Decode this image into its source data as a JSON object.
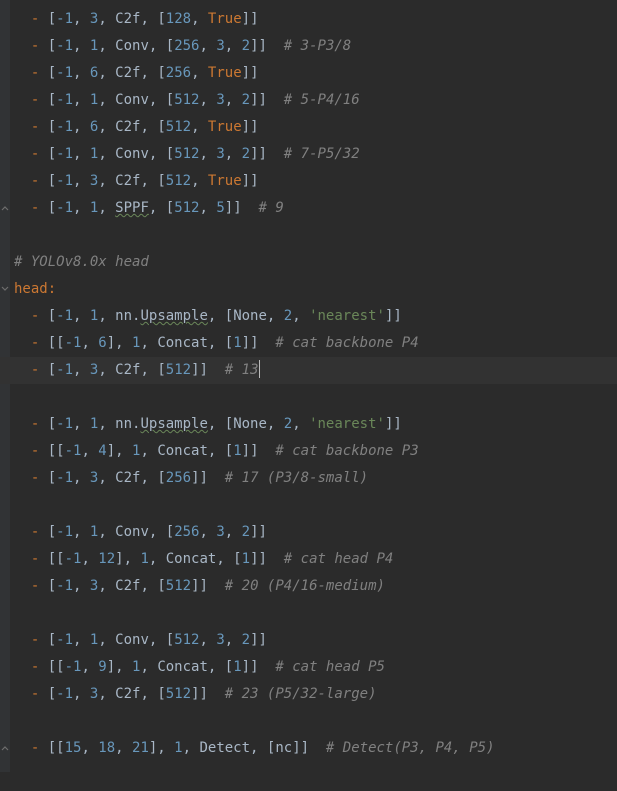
{
  "lines": [
    {
      "indent": "  ",
      "dash": "- ",
      "segs": [
        {
          "t": "bracket",
          "v": "["
        },
        {
          "t": "num",
          "v": "-1"
        },
        {
          "t": "bracket",
          "v": ", "
        },
        {
          "t": "num",
          "v": "3"
        },
        {
          "t": "bracket",
          "v": ", "
        },
        {
          "t": "ident",
          "v": "C2f"
        },
        {
          "t": "bracket",
          "v": ", ["
        },
        {
          "t": "num",
          "v": "128"
        },
        {
          "t": "bracket",
          "v": ", "
        },
        {
          "t": "bool",
          "v": "True"
        },
        {
          "t": "bracket",
          "v": "]]"
        }
      ]
    },
    {
      "indent": "  ",
      "dash": "- ",
      "segs": [
        {
          "t": "bracket",
          "v": "["
        },
        {
          "t": "num",
          "v": "-1"
        },
        {
          "t": "bracket",
          "v": ", "
        },
        {
          "t": "num",
          "v": "1"
        },
        {
          "t": "bracket",
          "v": ", "
        },
        {
          "t": "ident",
          "v": "Conv"
        },
        {
          "t": "bracket",
          "v": ", ["
        },
        {
          "t": "num",
          "v": "256"
        },
        {
          "t": "bracket",
          "v": ", "
        },
        {
          "t": "num",
          "v": "3"
        },
        {
          "t": "bracket",
          "v": ", "
        },
        {
          "t": "num",
          "v": "2"
        },
        {
          "t": "bracket",
          "v": "]]  "
        },
        {
          "t": "comment",
          "v": "# 3-P3/8"
        }
      ]
    },
    {
      "indent": "  ",
      "dash": "- ",
      "segs": [
        {
          "t": "bracket",
          "v": "["
        },
        {
          "t": "num",
          "v": "-1"
        },
        {
          "t": "bracket",
          "v": ", "
        },
        {
          "t": "num",
          "v": "6"
        },
        {
          "t": "bracket",
          "v": ", "
        },
        {
          "t": "ident",
          "v": "C2f"
        },
        {
          "t": "bracket",
          "v": ", ["
        },
        {
          "t": "num",
          "v": "256"
        },
        {
          "t": "bracket",
          "v": ", "
        },
        {
          "t": "bool",
          "v": "True"
        },
        {
          "t": "bracket",
          "v": "]]"
        }
      ]
    },
    {
      "indent": "  ",
      "dash": "- ",
      "segs": [
        {
          "t": "bracket",
          "v": "["
        },
        {
          "t": "num",
          "v": "-1"
        },
        {
          "t": "bracket",
          "v": ", "
        },
        {
          "t": "num",
          "v": "1"
        },
        {
          "t": "bracket",
          "v": ", "
        },
        {
          "t": "ident",
          "v": "Conv"
        },
        {
          "t": "bracket",
          "v": ", ["
        },
        {
          "t": "num",
          "v": "512"
        },
        {
          "t": "bracket",
          "v": ", "
        },
        {
          "t": "num",
          "v": "3"
        },
        {
          "t": "bracket",
          "v": ", "
        },
        {
          "t": "num",
          "v": "2"
        },
        {
          "t": "bracket",
          "v": "]]  "
        },
        {
          "t": "comment",
          "v": "# 5-P4/16"
        }
      ]
    },
    {
      "indent": "  ",
      "dash": "- ",
      "segs": [
        {
          "t": "bracket",
          "v": "["
        },
        {
          "t": "num",
          "v": "-1"
        },
        {
          "t": "bracket",
          "v": ", "
        },
        {
          "t": "num",
          "v": "6"
        },
        {
          "t": "bracket",
          "v": ", "
        },
        {
          "t": "ident",
          "v": "C2f"
        },
        {
          "t": "bracket",
          "v": ", ["
        },
        {
          "t": "num",
          "v": "512"
        },
        {
          "t": "bracket",
          "v": ", "
        },
        {
          "t": "bool",
          "v": "True"
        },
        {
          "t": "bracket",
          "v": "]]"
        }
      ]
    },
    {
      "indent": "  ",
      "dash": "- ",
      "segs": [
        {
          "t": "bracket",
          "v": "["
        },
        {
          "t": "num",
          "v": "-1"
        },
        {
          "t": "bracket",
          "v": ", "
        },
        {
          "t": "num",
          "v": "1"
        },
        {
          "t": "bracket",
          "v": ", "
        },
        {
          "t": "ident",
          "v": "Conv"
        },
        {
          "t": "bracket",
          "v": ", ["
        },
        {
          "t": "num",
          "v": "512"
        },
        {
          "t": "bracket",
          "v": ", "
        },
        {
          "t": "num",
          "v": "3"
        },
        {
          "t": "bracket",
          "v": ", "
        },
        {
          "t": "num",
          "v": "2"
        },
        {
          "t": "bracket",
          "v": "]]  "
        },
        {
          "t": "comment",
          "v": "# 7-P5/32"
        }
      ]
    },
    {
      "indent": "  ",
      "dash": "- ",
      "segs": [
        {
          "t": "bracket",
          "v": "["
        },
        {
          "t": "num",
          "v": "-1"
        },
        {
          "t": "bracket",
          "v": ", "
        },
        {
          "t": "num",
          "v": "3"
        },
        {
          "t": "bracket",
          "v": ", "
        },
        {
          "t": "ident",
          "v": "C2f"
        },
        {
          "t": "bracket",
          "v": ", ["
        },
        {
          "t": "num",
          "v": "512"
        },
        {
          "t": "bracket",
          "v": ", "
        },
        {
          "t": "bool",
          "v": "True"
        },
        {
          "t": "bracket",
          "v": "]]"
        }
      ]
    },
    {
      "indent": "  ",
      "dash": "- ",
      "fold": "up",
      "segs": [
        {
          "t": "bracket",
          "v": "["
        },
        {
          "t": "num",
          "v": "-1"
        },
        {
          "t": "bracket",
          "v": ", "
        },
        {
          "t": "num",
          "v": "1"
        },
        {
          "t": "bracket",
          "v": ", "
        },
        {
          "t": "typo",
          "v": "SPPF"
        },
        {
          "t": "bracket",
          "v": ", ["
        },
        {
          "t": "num",
          "v": "512"
        },
        {
          "t": "bracket",
          "v": ", "
        },
        {
          "t": "num",
          "v": "5"
        },
        {
          "t": "bracket",
          "v": "]]  "
        },
        {
          "t": "comment",
          "v": "# 9"
        }
      ]
    },
    {
      "blank": true
    },
    {
      "indent": "",
      "segs": [
        {
          "t": "comment",
          "v": "# YOLOv8.0x head"
        }
      ]
    },
    {
      "indent": "",
      "fold": "down",
      "segs": [
        {
          "t": "key",
          "v": "head"
        },
        {
          "t": "colon",
          "v": ":"
        }
      ]
    },
    {
      "indent": "  ",
      "dash": "- ",
      "segs": [
        {
          "t": "bracket",
          "v": "["
        },
        {
          "t": "num",
          "v": "-1"
        },
        {
          "t": "bracket",
          "v": ", "
        },
        {
          "t": "num",
          "v": "1"
        },
        {
          "t": "bracket",
          "v": ", "
        },
        {
          "t": "ident",
          "v": "nn."
        },
        {
          "t": "typo",
          "v": "Upsample"
        },
        {
          "t": "bracket",
          "v": ", ["
        },
        {
          "t": "ident",
          "v": "None"
        },
        {
          "t": "bracket",
          "v": ", "
        },
        {
          "t": "num",
          "v": "2"
        },
        {
          "t": "bracket",
          "v": ", "
        },
        {
          "t": "str",
          "v": "'nearest'"
        },
        {
          "t": "bracket",
          "v": "]]"
        }
      ]
    },
    {
      "indent": "  ",
      "dash": "- ",
      "segs": [
        {
          "t": "bracket",
          "v": "[["
        },
        {
          "t": "num",
          "v": "-1"
        },
        {
          "t": "bracket",
          "v": ", "
        },
        {
          "t": "num",
          "v": "6"
        },
        {
          "t": "bracket",
          "v": "], "
        },
        {
          "t": "num",
          "v": "1"
        },
        {
          "t": "bracket",
          "v": ", "
        },
        {
          "t": "ident",
          "v": "Concat"
        },
        {
          "t": "bracket",
          "v": ", ["
        },
        {
          "t": "num",
          "v": "1"
        },
        {
          "t": "bracket",
          "v": "]]  "
        },
        {
          "t": "comment",
          "v": "# cat backbone P4"
        }
      ]
    },
    {
      "indent": "  ",
      "dash": "- ",
      "highlight": true,
      "cursor": true,
      "segs": [
        {
          "t": "bracket",
          "v": "["
        },
        {
          "t": "num",
          "v": "-1"
        },
        {
          "t": "bracket",
          "v": ", "
        },
        {
          "t": "num",
          "v": "3"
        },
        {
          "t": "bracket",
          "v": ", "
        },
        {
          "t": "ident",
          "v": "C2f"
        },
        {
          "t": "bracket",
          "v": ", ["
        },
        {
          "t": "num",
          "v": "512"
        },
        {
          "t": "bracket",
          "v": "]]  "
        },
        {
          "t": "comment",
          "v": "# 13"
        }
      ]
    },
    {
      "blank": true
    },
    {
      "indent": "  ",
      "dash": "- ",
      "segs": [
        {
          "t": "bracket",
          "v": "["
        },
        {
          "t": "num",
          "v": "-1"
        },
        {
          "t": "bracket",
          "v": ", "
        },
        {
          "t": "num",
          "v": "1"
        },
        {
          "t": "bracket",
          "v": ", "
        },
        {
          "t": "ident",
          "v": "nn."
        },
        {
          "t": "typo",
          "v": "Upsample"
        },
        {
          "t": "bracket",
          "v": ", ["
        },
        {
          "t": "ident",
          "v": "None"
        },
        {
          "t": "bracket",
          "v": ", "
        },
        {
          "t": "num",
          "v": "2"
        },
        {
          "t": "bracket",
          "v": ", "
        },
        {
          "t": "str",
          "v": "'nearest'"
        },
        {
          "t": "bracket",
          "v": "]]"
        }
      ]
    },
    {
      "indent": "  ",
      "dash": "- ",
      "segs": [
        {
          "t": "bracket",
          "v": "[["
        },
        {
          "t": "num",
          "v": "-1"
        },
        {
          "t": "bracket",
          "v": ", "
        },
        {
          "t": "num",
          "v": "4"
        },
        {
          "t": "bracket",
          "v": "], "
        },
        {
          "t": "num",
          "v": "1"
        },
        {
          "t": "bracket",
          "v": ", "
        },
        {
          "t": "ident",
          "v": "Concat"
        },
        {
          "t": "bracket",
          "v": ", ["
        },
        {
          "t": "num",
          "v": "1"
        },
        {
          "t": "bracket",
          "v": "]]  "
        },
        {
          "t": "comment",
          "v": "# cat backbone P3"
        }
      ]
    },
    {
      "indent": "  ",
      "dash": "- ",
      "segs": [
        {
          "t": "bracket",
          "v": "["
        },
        {
          "t": "num",
          "v": "-1"
        },
        {
          "t": "bracket",
          "v": ", "
        },
        {
          "t": "num",
          "v": "3"
        },
        {
          "t": "bracket",
          "v": ", "
        },
        {
          "t": "ident",
          "v": "C2f"
        },
        {
          "t": "bracket",
          "v": ", ["
        },
        {
          "t": "num",
          "v": "256"
        },
        {
          "t": "bracket",
          "v": "]]  "
        },
        {
          "t": "comment",
          "v": "# 17 (P3/8-small)"
        }
      ]
    },
    {
      "blank": true
    },
    {
      "indent": "  ",
      "dash": "- ",
      "segs": [
        {
          "t": "bracket",
          "v": "["
        },
        {
          "t": "num",
          "v": "-1"
        },
        {
          "t": "bracket",
          "v": ", "
        },
        {
          "t": "num",
          "v": "1"
        },
        {
          "t": "bracket",
          "v": ", "
        },
        {
          "t": "ident",
          "v": "Conv"
        },
        {
          "t": "bracket",
          "v": ", ["
        },
        {
          "t": "num",
          "v": "256"
        },
        {
          "t": "bracket",
          "v": ", "
        },
        {
          "t": "num",
          "v": "3"
        },
        {
          "t": "bracket",
          "v": ", "
        },
        {
          "t": "num",
          "v": "2"
        },
        {
          "t": "bracket",
          "v": "]]"
        }
      ]
    },
    {
      "indent": "  ",
      "dash": "- ",
      "segs": [
        {
          "t": "bracket",
          "v": "[["
        },
        {
          "t": "num",
          "v": "-1"
        },
        {
          "t": "bracket",
          "v": ", "
        },
        {
          "t": "num",
          "v": "12"
        },
        {
          "t": "bracket",
          "v": "], "
        },
        {
          "t": "num",
          "v": "1"
        },
        {
          "t": "bracket",
          "v": ", "
        },
        {
          "t": "ident",
          "v": "Concat"
        },
        {
          "t": "bracket",
          "v": ", ["
        },
        {
          "t": "num",
          "v": "1"
        },
        {
          "t": "bracket",
          "v": "]]  "
        },
        {
          "t": "comment",
          "v": "# cat head P4"
        }
      ]
    },
    {
      "indent": "  ",
      "dash": "- ",
      "segs": [
        {
          "t": "bracket",
          "v": "["
        },
        {
          "t": "num",
          "v": "-1"
        },
        {
          "t": "bracket",
          "v": ", "
        },
        {
          "t": "num",
          "v": "3"
        },
        {
          "t": "bracket",
          "v": ", "
        },
        {
          "t": "ident",
          "v": "C2f"
        },
        {
          "t": "bracket",
          "v": ", ["
        },
        {
          "t": "num",
          "v": "512"
        },
        {
          "t": "bracket",
          "v": "]]  "
        },
        {
          "t": "comment",
          "v": "# 20 (P4/16-medium)"
        }
      ]
    },
    {
      "blank": true
    },
    {
      "indent": "  ",
      "dash": "- ",
      "segs": [
        {
          "t": "bracket",
          "v": "["
        },
        {
          "t": "num",
          "v": "-1"
        },
        {
          "t": "bracket",
          "v": ", "
        },
        {
          "t": "num",
          "v": "1"
        },
        {
          "t": "bracket",
          "v": ", "
        },
        {
          "t": "ident",
          "v": "Conv"
        },
        {
          "t": "bracket",
          "v": ", ["
        },
        {
          "t": "num",
          "v": "512"
        },
        {
          "t": "bracket",
          "v": ", "
        },
        {
          "t": "num",
          "v": "3"
        },
        {
          "t": "bracket",
          "v": ", "
        },
        {
          "t": "num",
          "v": "2"
        },
        {
          "t": "bracket",
          "v": "]]"
        }
      ]
    },
    {
      "indent": "  ",
      "dash": "- ",
      "segs": [
        {
          "t": "bracket",
          "v": "[["
        },
        {
          "t": "num",
          "v": "-1"
        },
        {
          "t": "bracket",
          "v": ", "
        },
        {
          "t": "num",
          "v": "9"
        },
        {
          "t": "bracket",
          "v": "], "
        },
        {
          "t": "num",
          "v": "1"
        },
        {
          "t": "bracket",
          "v": ", "
        },
        {
          "t": "ident",
          "v": "Concat"
        },
        {
          "t": "bracket",
          "v": ", ["
        },
        {
          "t": "num",
          "v": "1"
        },
        {
          "t": "bracket",
          "v": "]]  "
        },
        {
          "t": "comment",
          "v": "# cat head P5"
        }
      ]
    },
    {
      "indent": "  ",
      "dash": "- ",
      "segs": [
        {
          "t": "bracket",
          "v": "["
        },
        {
          "t": "num",
          "v": "-1"
        },
        {
          "t": "bracket",
          "v": ", "
        },
        {
          "t": "num",
          "v": "3"
        },
        {
          "t": "bracket",
          "v": ", "
        },
        {
          "t": "ident",
          "v": "C2f"
        },
        {
          "t": "bracket",
          "v": ", ["
        },
        {
          "t": "num",
          "v": "512"
        },
        {
          "t": "bracket",
          "v": "]]  "
        },
        {
          "t": "comment",
          "v": "# 23 (P5/32-large)"
        }
      ]
    },
    {
      "blank": true
    },
    {
      "indent": "  ",
      "dash": "- ",
      "fold": "up",
      "segs": [
        {
          "t": "bracket",
          "v": "[["
        },
        {
          "t": "num",
          "v": "15"
        },
        {
          "t": "bracket",
          "v": ", "
        },
        {
          "t": "num",
          "v": "18"
        },
        {
          "t": "bracket",
          "v": ", "
        },
        {
          "t": "num",
          "v": "21"
        },
        {
          "t": "bracket",
          "v": "], "
        },
        {
          "t": "num",
          "v": "1"
        },
        {
          "t": "bracket",
          "v": ", "
        },
        {
          "t": "ident",
          "v": "Detect"
        },
        {
          "t": "bracket",
          "v": ", ["
        },
        {
          "t": "ident",
          "v": "nc"
        },
        {
          "t": "bracket",
          "v": "]]  "
        },
        {
          "t": "comment",
          "v": "# Detect(P3, P4, P5)"
        }
      ]
    }
  ]
}
